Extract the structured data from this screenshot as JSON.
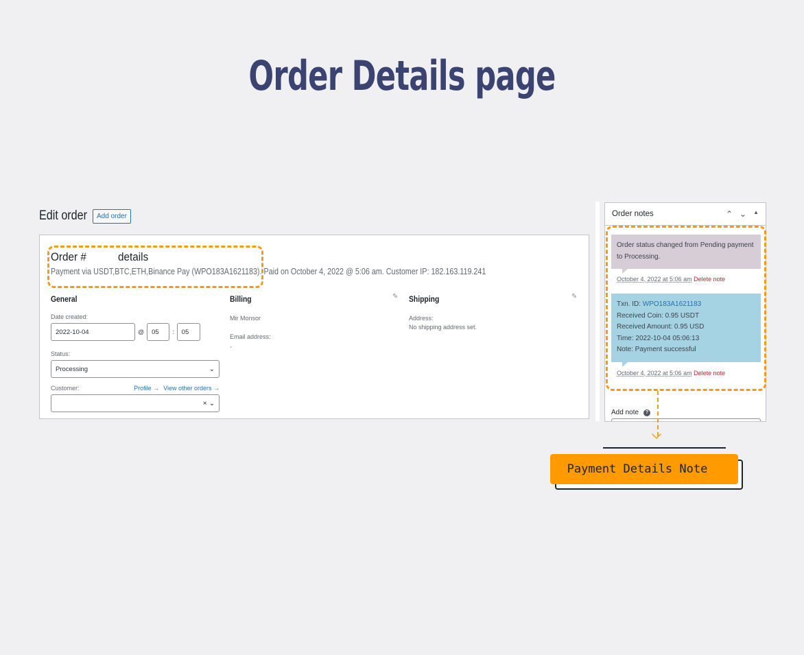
{
  "page_title": "Order Details page",
  "edit_order": {
    "title": "Edit order",
    "add_order_label": "Add order",
    "order_heading_prefix": "Order #",
    "order_heading_suffix": "details",
    "meta": "Payment via USDT,BTC,ETH,Binance Pay (WPO183A1621183). Paid on October 4, 2022 @ 5:06 am. Customer IP: 182.163.119.241"
  },
  "general": {
    "title": "General",
    "date_created_label": "Date created:",
    "date_value": "2022-10-04",
    "at_symbol": "@",
    "hour_value": "05",
    "colon": ":",
    "minute_value": "05",
    "status_label": "Status:",
    "status_value": "Processing",
    "customer_label": "Customer:",
    "profile_link": "Profile →",
    "view_orders_link": "View other orders →",
    "clear_symbol": "×"
  },
  "billing": {
    "title": "Billing",
    "name": "Mir Monsor",
    "email_label": "Email address:",
    "email_value": ","
  },
  "shipping": {
    "title": "Shipping",
    "address_label": "Address:",
    "address_value": "No shipping address set."
  },
  "order_notes": {
    "title": "Order notes",
    "notes": [
      {
        "text": "Order status changed from Pending payment to Processing.",
        "date": "October 4, 2022 at 5:06 am",
        "delete_label": "Delete note"
      },
      {
        "txn_label": "Txn. ID:",
        "txn_id": "WPO183A1621183",
        "received_coin": "Received Coin: 0.95 USDT",
        "received_amount": "Received Amount: 0.95 USD",
        "time": "Time: 2022-10-04 05:06:13",
        "note": "Note: Payment successful",
        "date": "October 4, 2022 at 5:06 am",
        "delete_label": "Delete note"
      }
    ],
    "add_note_label": "Add note"
  },
  "callout_label": "Payment Details Note",
  "colors": {
    "title": "#3b4371",
    "highlight": "#f29b16",
    "callout": "#ff9a00",
    "link": "#2271b1",
    "delete": "#b32d2e",
    "note_system": "#d6cdd6",
    "note_payment": "#a6d3e3"
  },
  "icons": [
    "pencil-icon",
    "chevron-up-icon",
    "chevron-down-icon",
    "triangle-up-icon",
    "help-icon",
    "chevron-down-select-icon",
    "arrow-down-icon"
  ]
}
